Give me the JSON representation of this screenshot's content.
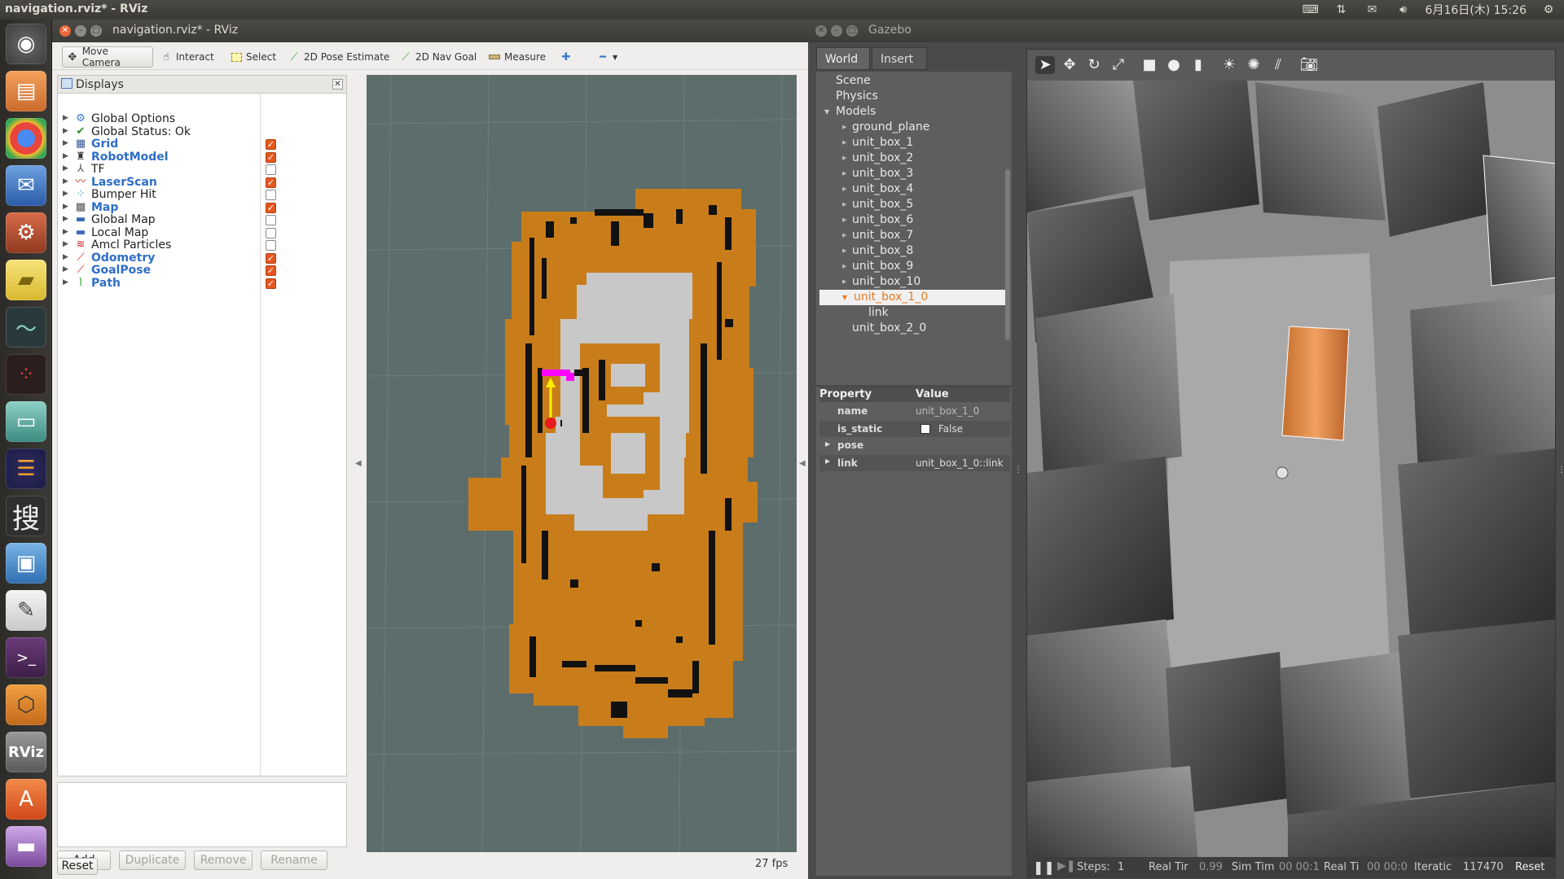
{
  "top_panel": {
    "window_title": "navigation.rviz* - RViz",
    "datetime": "6月16日(木) 15:26"
  },
  "launcher": {
    "items": [
      "ubuntu-dash-icon",
      "files-icon",
      "chrome-icon",
      "thunderbird-icon",
      "settings-icon",
      "sticky-notes-icon",
      "system-monitor-icon",
      "app-icon",
      "network-icon",
      "eclipse-icon",
      "sougou-icon",
      "remote-desktop-icon",
      "text-editor-icon",
      "terminal-icon",
      "box-icon",
      "rviz-icon",
      "software-center-icon",
      "drive-icon"
    ],
    "rviz_label": "RViz",
    "sou_label": "搜"
  },
  "rviz": {
    "title": "navigation.rviz* - RViz",
    "tools": {
      "move_camera": "Move Camera",
      "interact": "Interact",
      "select": "Select",
      "pose_estimate": "2D Pose Estimate",
      "nav_goal": "2D Nav Goal",
      "measure": "Measure"
    },
    "displays": {
      "title": "Displays",
      "items": [
        {
          "label": "Global Options",
          "icon": "globe-gear-icon",
          "checkbox": null,
          "highlight": false
        },
        {
          "label": "Global Status: Ok",
          "icon": "check-icon",
          "checkbox": null,
          "highlight": false
        },
        {
          "label": "Grid",
          "icon": "grid-icon",
          "checkbox": true,
          "highlight": true
        },
        {
          "label": "RobotModel",
          "icon": "robot-icon",
          "checkbox": true,
          "highlight": true
        },
        {
          "label": "TF",
          "icon": "axes-icon",
          "checkbox": false,
          "highlight": false
        },
        {
          "label": "LaserScan",
          "icon": "laser-icon",
          "checkbox": true,
          "highlight": true
        },
        {
          "label": "Bumper Hit",
          "icon": "points-icon",
          "checkbox": false,
          "highlight": false
        },
        {
          "label": "Map",
          "icon": "map-icon",
          "checkbox": true,
          "highlight": true
        },
        {
          "label": "Global Map",
          "icon": "folder-icon",
          "checkbox": false,
          "highlight": false
        },
        {
          "label": "Local Map",
          "icon": "folder-icon",
          "checkbox": false,
          "highlight": false
        },
        {
          "label": "Amcl Particles",
          "icon": "pose-array-icon",
          "checkbox": false,
          "highlight": false
        },
        {
          "label": "Odometry",
          "icon": "odometry-icon",
          "checkbox": true,
          "highlight": true
        },
        {
          "label": "GoalPose",
          "icon": "pose-icon",
          "checkbox": true,
          "highlight": true
        },
        {
          "label": "Path",
          "icon": "path-icon",
          "checkbox": true,
          "highlight": true
        }
      ]
    },
    "buttons": {
      "add": "Add",
      "duplicate": "Duplicate",
      "remove": "Remove",
      "rename": "Rename",
      "reset": "Reset"
    },
    "fps": "27 fps"
  },
  "gazebo": {
    "title": "Gazebo",
    "tabs": [
      "World",
      "Insert"
    ],
    "tree": {
      "top": [
        "Scene",
        "Physics",
        "Models"
      ],
      "models": [
        "ground_plane",
        "unit_box_1",
        "unit_box_2",
        "unit_box_3",
        "unit_box_4",
        "unit_box_5",
        "unit_box_6",
        "unit_box_7",
        "unit_box_8",
        "unit_box_9",
        "unit_box_10"
      ],
      "selected": "unit_box_1_0",
      "child": "link",
      "next": "unit_box_2_0"
    },
    "properties": {
      "header": [
        "Property",
        "Value"
      ],
      "rows": [
        {
          "name": "name",
          "value": "unit_box_1_0"
        },
        {
          "name": "is_static",
          "value": "False"
        },
        {
          "name": "pose",
          "value": ""
        },
        {
          "name": "link",
          "value": "unit_box_1_0::link"
        }
      ]
    },
    "status": {
      "steps_label": "Steps:",
      "steps_value": "1",
      "real_time_factor_label": "Real Tir",
      "real_time_factor": "0.99",
      "sim_time_label": "Sim Tim",
      "sim_time": "00 00:1",
      "real_time_label": "Real Ti",
      "real_time": "00 00:0",
      "iterations_label": "Iteratic",
      "iterations": "117470",
      "reset": "Reset"
    }
  },
  "colors": {
    "accent": "#e5571f",
    "costmap": "#c87d1a",
    "free": "#c8c8c8",
    "gazebo_selected": "#e57a23"
  }
}
